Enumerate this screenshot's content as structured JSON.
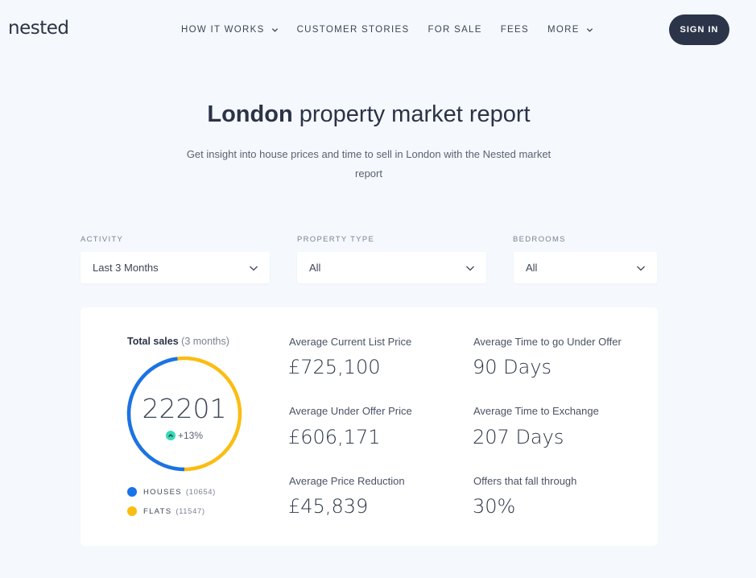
{
  "header": {
    "logo": "nested",
    "nav": [
      {
        "label": "HOW IT WORKS",
        "has_dropdown": true
      },
      {
        "label": "CUSTOMER STORIES",
        "has_dropdown": false
      },
      {
        "label": "FOR SALE",
        "has_dropdown": false
      },
      {
        "label": "FEES",
        "has_dropdown": false
      },
      {
        "label": "MORE",
        "has_dropdown": true
      }
    ],
    "signin_label": "SIGN IN"
  },
  "hero": {
    "title_bold": "London",
    "title_rest": "property market report",
    "subtitle": "Get insight into house prices and time to sell in London with the Nested market report"
  },
  "filters": {
    "activity": {
      "label": "ACTIVITY",
      "value": "Last 3 Months"
    },
    "property_type": {
      "label": "PROPERTY TYPE",
      "value": "All"
    },
    "bedrooms": {
      "label": "BEDROOMS",
      "value": "All"
    }
  },
  "summary": {
    "total_label": "Total sales",
    "total_period": "(3 months)",
    "total_value": "22201",
    "change": "+13%",
    "legend": [
      {
        "label": "HOUSES",
        "count": "(10654)",
        "value": 10654,
        "color": "#1a73e8"
      },
      {
        "label": "FLATS",
        "count": "(11547)",
        "value": 11547,
        "color": "#fbbd12"
      }
    ]
  },
  "stats": {
    "avg_list_price": {
      "label": "Average Current List Price",
      "value": "£725,100"
    },
    "avg_under_offer_price": {
      "label": "Average Under Offer Price",
      "value": "£606,171"
    },
    "avg_price_reduction": {
      "label": "Average Price Reduction",
      "value": "£45,839"
    },
    "avg_time_under_offer": {
      "label": "Average Time to go Under Offer",
      "value": "90 Days"
    },
    "avg_time_exchange": {
      "label": "Average Time to Exchange",
      "value": "207 Days"
    },
    "offers_fall_through": {
      "label": "Offers that fall through",
      "value": "30%"
    }
  },
  "colors": {
    "accent_dark": "#2b3448",
    "houses": "#1a73e8",
    "flats": "#fbbd12",
    "positive": "#38d9b7"
  }
}
